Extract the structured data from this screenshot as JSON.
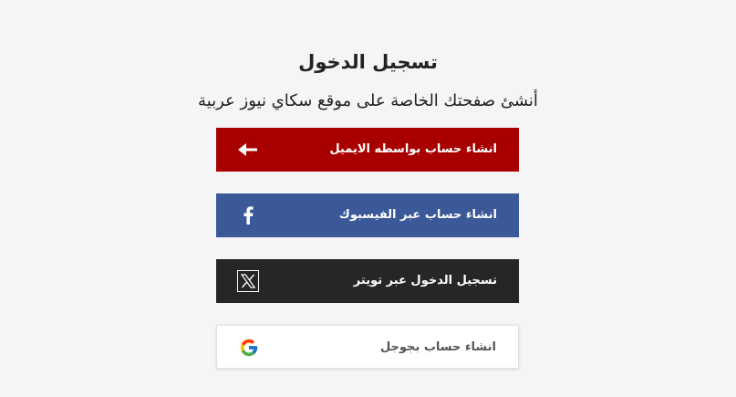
{
  "header": {
    "title": "تسجيل الدخول",
    "subtitle": "أنشئ صفحتك الخاصة على موقع سكاي نيوز عربية"
  },
  "buttons": {
    "email": {
      "label": "انشاء حساب بواسطه الايميل",
      "icon": "arrow-left-icon",
      "color": "#a80000"
    },
    "facebook": {
      "label": "انشاء حساب عبر الفيسبوك",
      "icon": "facebook-icon",
      "color": "#3b5998"
    },
    "twitter": {
      "label": "تسجيل الدخول عبر تويتر",
      "icon": "x-twitter-icon",
      "color": "#262626"
    },
    "google": {
      "label": "انشاء حساب بجوجل",
      "icon": "google-icon",
      "color": "#ffffff"
    }
  }
}
